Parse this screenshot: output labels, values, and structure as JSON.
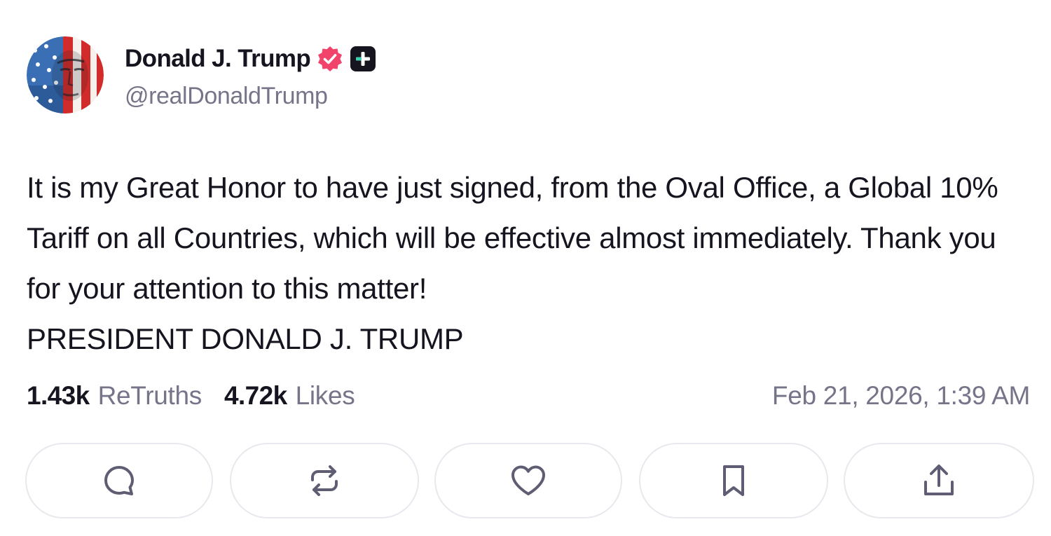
{
  "author": {
    "display_name": "Donald J. Trump",
    "handle": "@realDonaldTrump",
    "verified": true,
    "verified_badge_color": "#f2446a",
    "icons": {
      "verified": "verified-check-icon",
      "plus": "plus-badge-icon"
    }
  },
  "post": {
    "body": "It is my Great Honor to have just signed, from the Oval Office, a Global 10% Tariff on all Countries, which will be effective almost immediately. Thank you for your attention to this matter!\nPRESIDENT DONALD J. TRUMP"
  },
  "stats": {
    "retruths_count": "1.43k",
    "retruths_label": "ReTruths",
    "likes_count": "4.72k",
    "likes_label": "Likes",
    "timestamp": "Feb 21, 2026, 1:39 AM"
  },
  "actions": [
    {
      "name": "reply",
      "icon": "reply-icon"
    },
    {
      "name": "retruth",
      "icon": "retruth-icon"
    },
    {
      "name": "like",
      "icon": "heart-icon"
    },
    {
      "name": "bookmark",
      "icon": "bookmark-icon"
    },
    {
      "name": "share",
      "icon": "share-icon"
    }
  ],
  "colors": {
    "text_primary": "#16141f",
    "text_secondary": "#767489",
    "button_border": "#e8e8ee",
    "icon": "#5f5d73"
  }
}
